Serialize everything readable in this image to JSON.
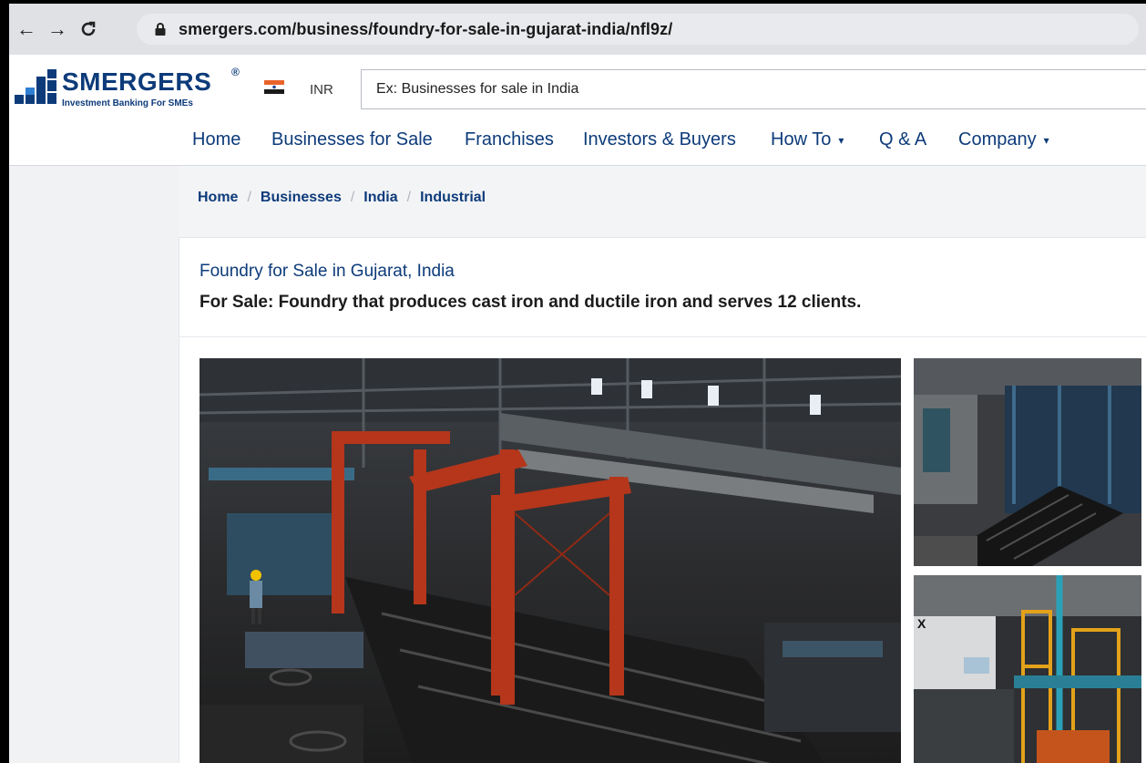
{
  "browser": {
    "url": "smergers.com/business/foundry-for-sale-in-gujarat-india/nfl9z/"
  },
  "header": {
    "brand": "SMERGERS",
    "tagline": "Investment Banking For SMEs",
    "currency": "INR",
    "search_placeholder": "Ex: Businesses for sale in India"
  },
  "nav": {
    "items": [
      {
        "label": "Home"
      },
      {
        "label": "Businesses for Sale"
      },
      {
        "label": "Franchises"
      },
      {
        "label": "Investors & Buyers"
      },
      {
        "label": "How To",
        "dropdown": true
      },
      {
        "label": "Q & A"
      },
      {
        "label": "Company",
        "dropdown": true
      }
    ]
  },
  "breadcrumbs": [
    "Home",
    "Businesses",
    "India",
    "Industrial"
  ],
  "listing": {
    "title": "Foundry for Sale in Gujarat, India",
    "subtitle": "For Sale: Foundry that produces cast iron and ductile iron and serves 12 clients."
  },
  "colors": {
    "brand": "#0d3b7a",
    "accent_red": "#b5361b"
  }
}
